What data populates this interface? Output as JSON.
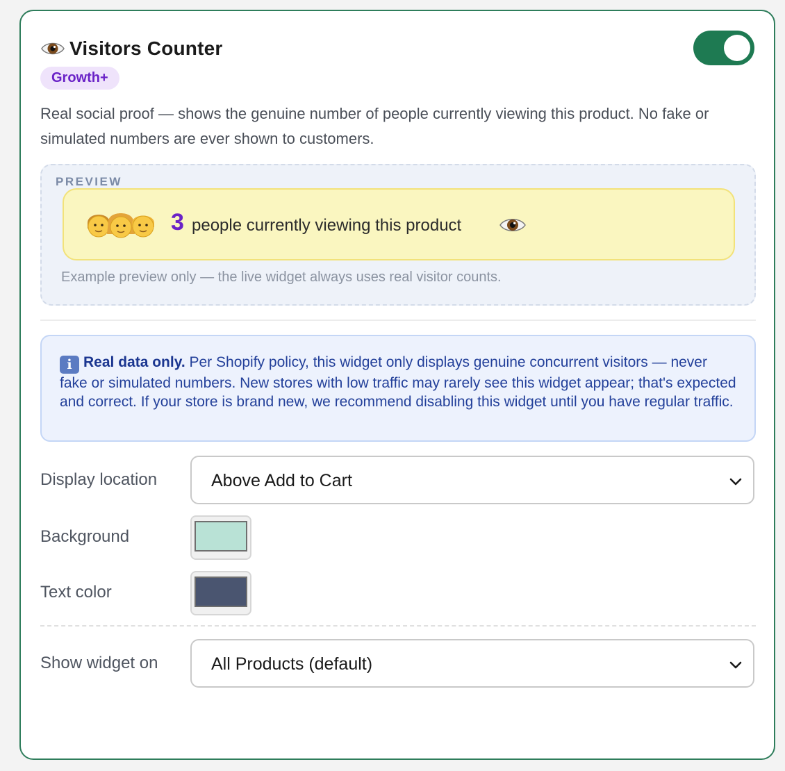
{
  "header": {
    "title": "Visitors Counter",
    "icon": "eye-icon",
    "enabled": true,
    "badge": "Growth+"
  },
  "description": "Real social proof — shows the genuine number of people currently viewing this product. No fake or simulated numbers are ever shown to customers.",
  "preview": {
    "label": "PREVIEW",
    "count": "3",
    "text": "people currently viewing this product",
    "note": "Example preview only — the live widget always uses real visitor counts."
  },
  "info": {
    "icon": "info-icon",
    "strong": "Real data only.",
    "text": "Per Shopify policy, this widget only displays genuine concurrent visitors — never fake or simulated numbers. New stores with low traffic may rarely see this widget appear; that's expected and correct. If your store is brand new, we recommend disabling this widget until you have regular traffic."
  },
  "fields": {
    "display_location": {
      "label": "Display location",
      "value": "Above Add to Cart"
    },
    "background": {
      "label": "Background",
      "color": "#b9e2d6"
    },
    "text_color": {
      "label": "Text color",
      "color": "#4a5570"
    },
    "show_on": {
      "label": "Show widget on",
      "value": "All Products (default)"
    }
  },
  "colors": {
    "accent_green": "#1e7a52",
    "badge_purple": "#6a22c7",
    "preview_yellow": "#faf6c0",
    "info_blue": "#edf2fd"
  }
}
